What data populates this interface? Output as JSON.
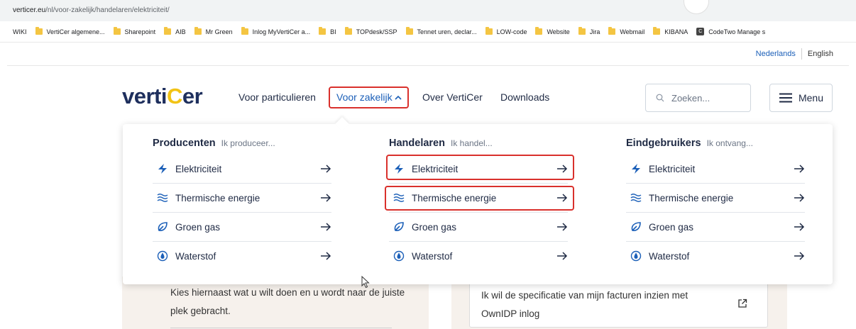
{
  "browser": {
    "url_host": "verticer.eu",
    "url_path": "/nl/voor-zakelijk/handelaren/elektriciteit/",
    "bookmarks": [
      {
        "label": "WIKI",
        "icon": "none"
      },
      {
        "label": "VertiCer algemene...",
        "icon": "folder-icon"
      },
      {
        "label": "Sharepoint",
        "icon": "folder-icon"
      },
      {
        "label": "AIB",
        "icon": "folder-icon"
      },
      {
        "label": "Mr Green",
        "icon": "folder-icon"
      },
      {
        "label": "Inlog MyVertiCer a...",
        "icon": "folder-icon"
      },
      {
        "label": "BI",
        "icon": "folder-icon"
      },
      {
        "label": "TOPdesk/SSP",
        "icon": "folder-icon"
      },
      {
        "label": "Tennet uren, declar...",
        "icon": "folder-icon"
      },
      {
        "label": "LOW-code",
        "icon": "folder-icon"
      },
      {
        "label": "Website",
        "icon": "folder-icon"
      },
      {
        "label": "Jira",
        "icon": "folder-icon"
      },
      {
        "label": "Webmail",
        "icon": "folder-icon"
      },
      {
        "label": "KIBANA",
        "icon": "folder-icon"
      },
      {
        "label": "CodeTwo Manage s",
        "icon": "codetwo-icon"
      }
    ]
  },
  "language": {
    "nl": "Nederlands",
    "en": "English"
  },
  "header": {
    "logo_pre": "verti",
    "logo_c": "C",
    "logo_post": "er",
    "nav": {
      "particulieren": "Voor particulieren",
      "zakelijk": "Voor zakelijk",
      "over": "Over VertiCer",
      "downloads": "Downloads"
    },
    "search_placeholder": "Zoeken...",
    "menu_label": "Menu"
  },
  "dropdown": {
    "columns": [
      {
        "title": "Producenten",
        "subtitle": "Ik produceer...",
        "items": [
          {
            "label": "Elektriciteit",
            "icon": "lightning-icon"
          },
          {
            "label": "Thermische energie",
            "icon": "heat-waves-icon"
          },
          {
            "label": "Groen gas",
            "icon": "leaf-icon"
          },
          {
            "label": "Waterstof",
            "icon": "drop-icon"
          }
        ]
      },
      {
        "title": "Handelaren",
        "subtitle": "Ik handel...",
        "items": [
          {
            "label": "Elektriciteit",
            "icon": "lightning-icon"
          },
          {
            "label": "Thermische energie",
            "icon": "heat-waves-icon"
          },
          {
            "label": "Groen gas",
            "icon": "leaf-icon"
          },
          {
            "label": "Waterstof",
            "icon": "drop-icon"
          }
        ]
      },
      {
        "title": "Eindgebruikers",
        "subtitle": "Ik ontvang...",
        "items": [
          {
            "label": "Elektriciteit",
            "icon": "lightning-icon"
          },
          {
            "label": "Thermische energie",
            "icon": "heat-waves-icon"
          },
          {
            "label": "Groen gas",
            "icon": "leaf-icon"
          },
          {
            "label": "Waterstof",
            "icon": "drop-icon"
          }
        ]
      }
    ]
  },
  "background": {
    "intro_text": "Kies hiernaast wat u wilt doen en u wordt naar de juiste plek gebracht.",
    "card_text": "Ik wil de specificatie van mijn facturen inzien met OwnIDP inlog"
  },
  "colors": {
    "brand_navy": "#1e2f5d",
    "brand_yellow": "#f2c315",
    "link_blue": "#1b5fb8",
    "highlight_red": "#d9302c",
    "beige": "#f6f1ec"
  }
}
